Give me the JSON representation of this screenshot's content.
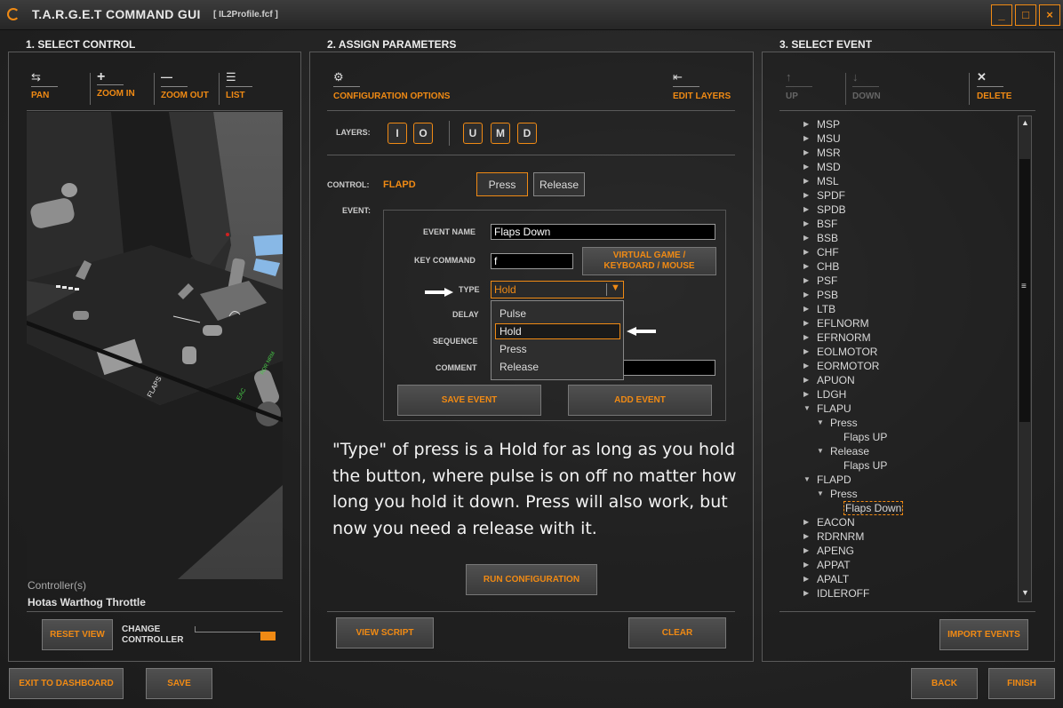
{
  "window": {
    "title": "T.A.R.G.E.T COMMAND GUI",
    "file": "[ IL2Profile.fcf ]",
    "minimize": "_",
    "maximize": "□",
    "close": "×"
  },
  "select_control": {
    "title": "1. SELECT CONTROL",
    "tools": [
      {
        "icon": "⇆",
        "label": "PAN"
      },
      {
        "icon": "+",
        "label": "ZOOM IN"
      },
      {
        "icon": "—",
        "label": "ZOOM OUT"
      },
      {
        "icon": "☰",
        "label": "LIST"
      }
    ],
    "controller_caption": "Controller(s)",
    "controller_name": "Hotas Warthog Throttle",
    "reset_view": "RESET VIEW",
    "change_controller": "CHANGE CONTROLLER",
    "device_labels": {
      "flaps": "FLAPS",
      "eac": "EAC",
      "rdr": "RDR NRM"
    }
  },
  "assign_parameters": {
    "title": "2. ASSIGN PARAMETERS",
    "config_options": "CONFIGURATION OPTIONS",
    "edit_layers": "EDIT LAYERS",
    "layers_label": "LAYERS:",
    "layers": [
      "I",
      "O",
      "U",
      "M",
      "D"
    ],
    "control_label": "CONTROL:",
    "control_value": "FLAPD",
    "press": "Press",
    "release": "Release",
    "event_label": "EVENT:",
    "event_name_label": "EVENT NAME",
    "event_name_value": "Flaps Down",
    "key_command_label": "KEY COMMAND",
    "key_command_value": "f",
    "virtual_btn": "VIRTUAL GAME / KEYBOARD / MOUSE",
    "type_label": "TYPE",
    "type_value": "Hold",
    "type_options": [
      "Pulse",
      "Hold",
      "Press",
      "Release"
    ],
    "delay_label": "DELAY",
    "sequence_label": "SEQUENCE",
    "comment_label": "COMMENT",
    "save_event": "SAVE EVENT",
    "add_event": "ADD EVENT",
    "annotation": "\"Type\" of press is a Hold for as long as you hold the button, where pulse is on off no matter how long you hold it down. Press will also work, but now you need a release with it.",
    "run_configuration": "RUN CONFIGURATION",
    "view_script": "VIEW SCRIPT",
    "clear": "CLEAR"
  },
  "select_event": {
    "title": "3. SELECT EVENT",
    "up": "UP",
    "down": "DOWN",
    "delete": "DELETE",
    "import_events": "IMPORT EVENTS",
    "tree": [
      {
        "label": "MSP",
        "level": 0,
        "tri": "right"
      },
      {
        "label": "MSU",
        "level": 0,
        "tri": "right"
      },
      {
        "label": "MSR",
        "level": 0,
        "tri": "right"
      },
      {
        "label": "MSD",
        "level": 0,
        "tri": "right"
      },
      {
        "label": "MSL",
        "level": 0,
        "tri": "right"
      },
      {
        "label": "SPDF",
        "level": 0,
        "tri": "right"
      },
      {
        "label": "SPDB",
        "level": 0,
        "tri": "right"
      },
      {
        "label": "BSF",
        "level": 0,
        "tri": "right"
      },
      {
        "label": "BSB",
        "level": 0,
        "tri": "right"
      },
      {
        "label": "CHF",
        "level": 0,
        "tri": "right"
      },
      {
        "label": "CHB",
        "level": 0,
        "tri": "right"
      },
      {
        "label": "PSF",
        "level": 0,
        "tri": "right"
      },
      {
        "label": "PSB",
        "level": 0,
        "tri": "right"
      },
      {
        "label": "LTB",
        "level": 0,
        "tri": "right"
      },
      {
        "label": "EFLNORM",
        "level": 0,
        "tri": "right"
      },
      {
        "label": "EFRNORM",
        "level": 0,
        "tri": "right"
      },
      {
        "label": "EOLMOTOR",
        "level": 0,
        "tri": "right"
      },
      {
        "label": "EORMOTOR",
        "level": 0,
        "tri": "right"
      },
      {
        "label": "APUON",
        "level": 0,
        "tri": "right"
      },
      {
        "label": "LDGH",
        "level": 0,
        "tri": "right"
      },
      {
        "label": "FLAPU",
        "level": 0,
        "tri": "down"
      },
      {
        "label": "Press",
        "level": 1,
        "tri": "down"
      },
      {
        "label": "Flaps UP",
        "level": 2,
        "tri": ""
      },
      {
        "label": "Release",
        "level": 1,
        "tri": "down"
      },
      {
        "label": "Flaps UP",
        "level": 2,
        "tri": ""
      },
      {
        "label": "FLAPD",
        "level": 0,
        "tri": "down"
      },
      {
        "label": "Press",
        "level": 1,
        "tri": "down"
      },
      {
        "label": "Flaps Down",
        "level": 2,
        "tri": "",
        "selected": true
      },
      {
        "label": "EACON",
        "level": 0,
        "tri": "right"
      },
      {
        "label": "RDRNRM",
        "level": 0,
        "tri": "right"
      },
      {
        "label": "APENG",
        "level": 0,
        "tri": "right"
      },
      {
        "label": "APPAT",
        "level": 0,
        "tri": "right"
      },
      {
        "label": "APALT",
        "level": 0,
        "tri": "right"
      },
      {
        "label": "IDLEROFF",
        "level": 0,
        "tri": "right"
      }
    ]
  },
  "footer": {
    "exit": "EXIT TO DASHBOARD",
    "save": "SAVE",
    "back": "BACK",
    "finish": "FINISH"
  }
}
